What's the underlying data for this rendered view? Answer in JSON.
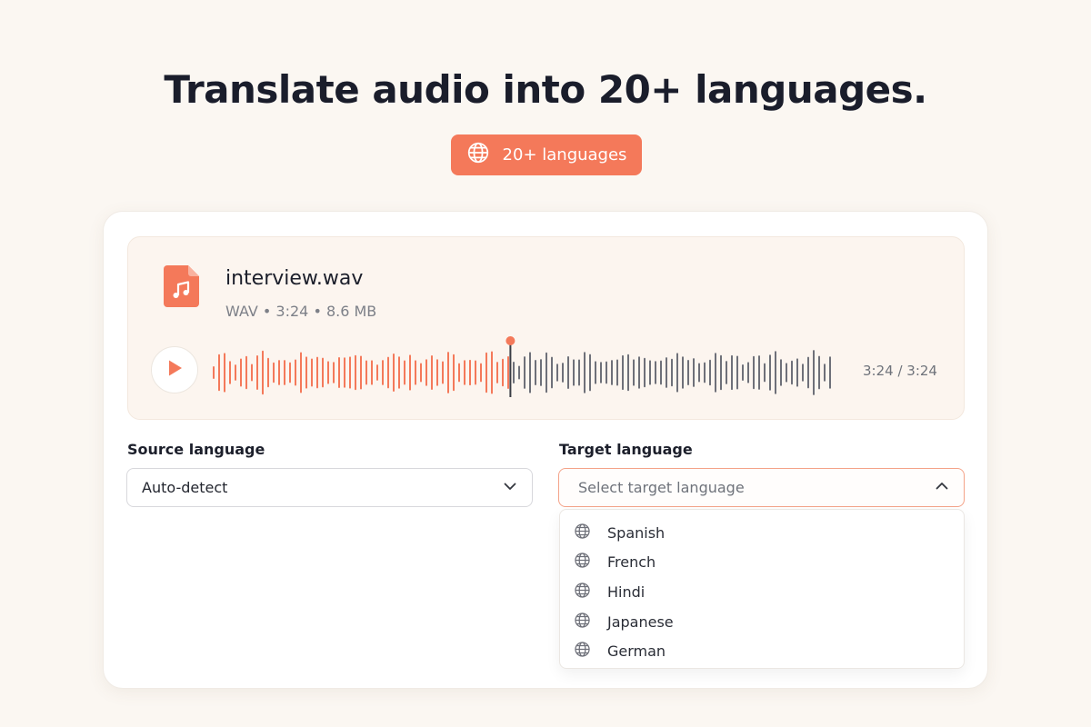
{
  "hero": {
    "title": "Translate audio into 20+ languages.",
    "badge_icon": "globe-icon",
    "badge_label": "20+ languages"
  },
  "file": {
    "icon": "music-file-icon",
    "name": "interview.wav",
    "meta": "WAV • 3:24 • 8.6 MB",
    "time_readout": "3:24 / 3:24",
    "playhead_fraction": 0.48
  },
  "source": {
    "label": "Source language",
    "value": "Auto-detect"
  },
  "target": {
    "label": "Target language",
    "placeholder": "Select target language",
    "options": [
      {
        "label": "Spanish",
        "icon": "globe-icon"
      },
      {
        "label": "French",
        "icon": "globe-icon"
      },
      {
        "label": "Hindi",
        "icon": "globe-icon"
      },
      {
        "label": "Japanese",
        "icon": "globe-icon"
      },
      {
        "label": "German",
        "icon": "globe-icon"
      }
    ]
  },
  "colors": {
    "accent": "#f4795a",
    "played_wave": "#f4795a",
    "unplayed_wave": "#6e7079",
    "playhead": "#3a3d45"
  }
}
